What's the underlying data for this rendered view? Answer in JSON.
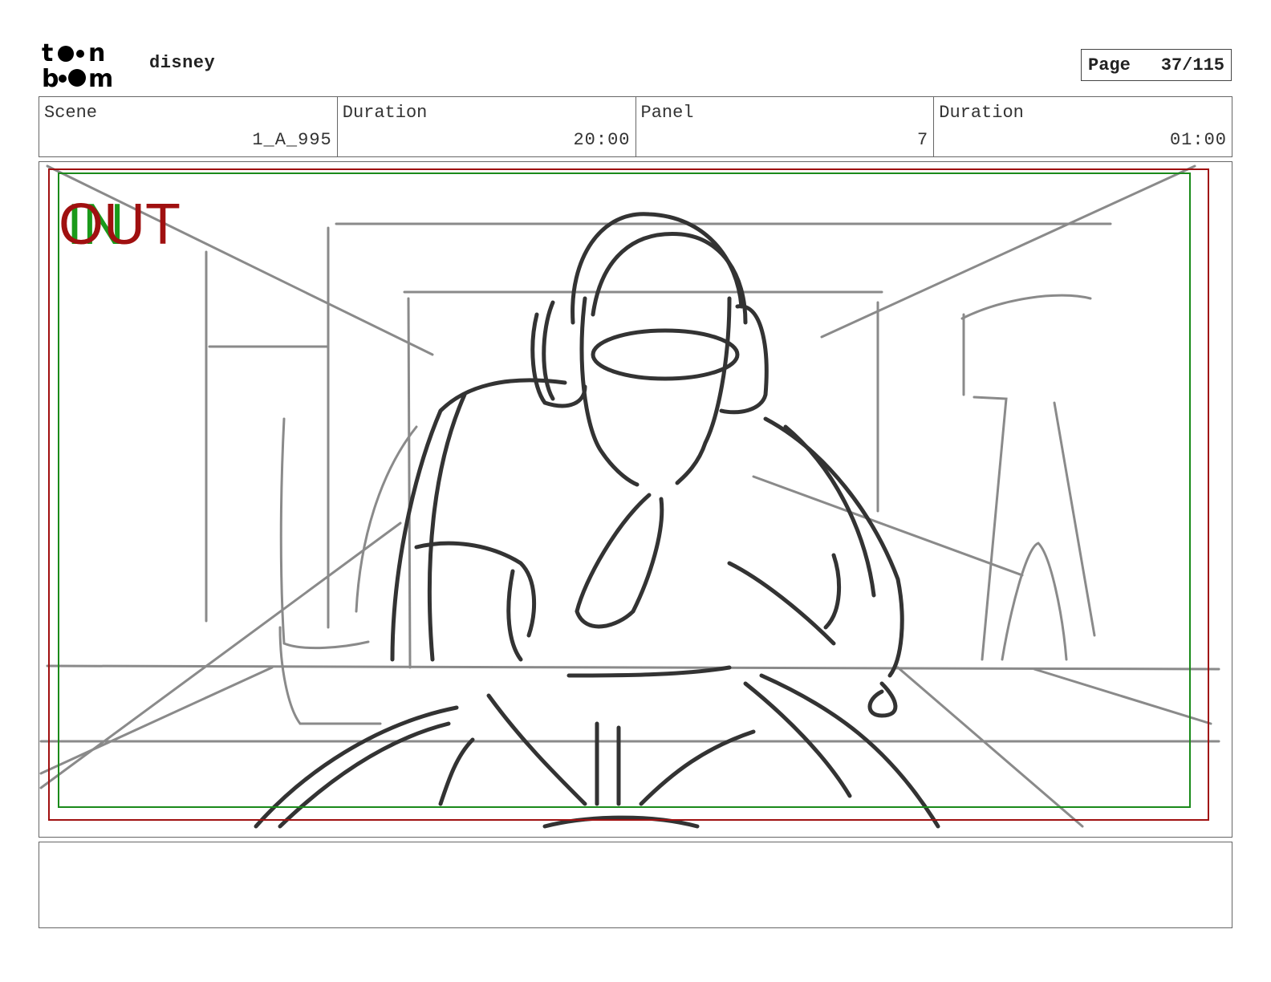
{
  "header": {
    "logo_text": "toon boom",
    "project": "disney",
    "page_label": "Page",
    "page_value": "37/115"
  },
  "info": {
    "scene_label": "Scene",
    "scene_value": "1_A_995",
    "duration_label": "Duration",
    "duration_value": "20:00",
    "panel_label": "Panel",
    "panel_value": "7",
    "panel_duration_label": "Duration",
    "panel_duration_value": "01:00"
  },
  "frame": {
    "in_label": "IN",
    "out_label": "OUT",
    "in_color": "#1a9a1a",
    "out_color": "#a01010"
  },
  "notes": {
    "text": ""
  }
}
